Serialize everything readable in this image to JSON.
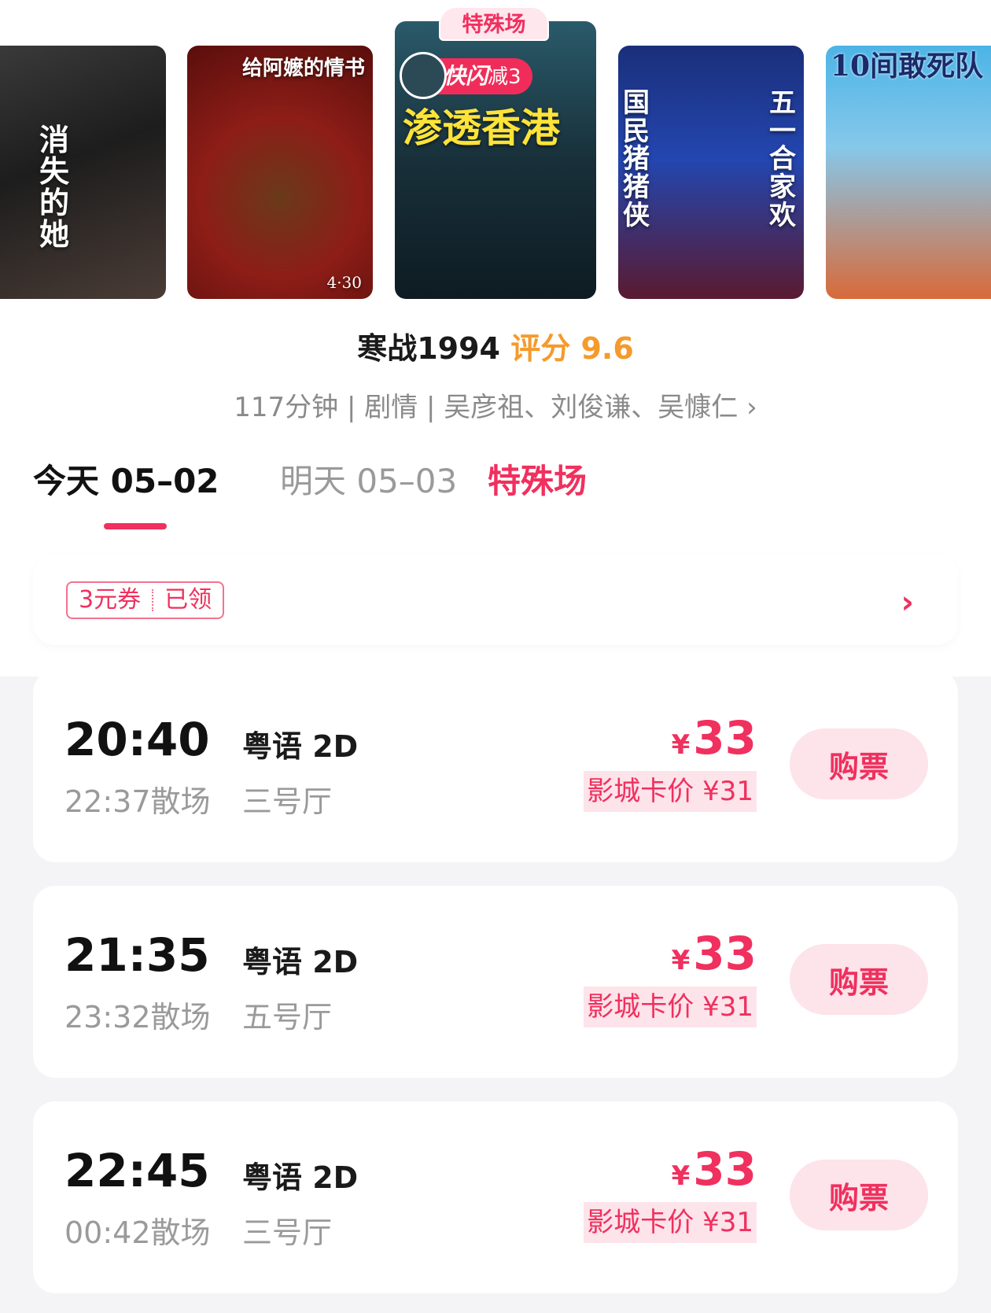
{
  "posters": [
    {
      "text": "消失的她"
    },
    {
      "text": "给阿嬷的情书",
      "date": "4·30"
    },
    {
      "text": "渗透香港"
    },
    {
      "text": "国民猪猪侠",
      "side_text": "五一合家欢"
    },
    {
      "text": "10间敢死队"
    }
  ],
  "poster_tag": "特殊场",
  "flash_badge": {
    "brand": "快闪",
    "discount": "减3"
  },
  "movie": {
    "title": "寒战1994",
    "score_label": "评分",
    "score": "9.6",
    "meta": "117分钟 | 剧情 | 吴彦祖、刘俊谦、吴慷仁 ›"
  },
  "tabs": {
    "today": "今天 05–02",
    "tomorrow": "明天 05–03",
    "special": "特殊场"
  },
  "coupon": {
    "amount": "3元券",
    "status": "已领",
    "chevron": "›"
  },
  "showtimes": [
    {
      "start": "20:40",
      "end": "22:37散场",
      "lang": "粤语 2D",
      "hall": "三号厅",
      "currency": "¥",
      "price": "33",
      "card_price": "影城卡价 ¥31",
      "buy_label": "购票"
    },
    {
      "start": "21:35",
      "end": "23:32散场",
      "lang": "粤语 2D",
      "hall": "五号厅",
      "currency": "¥",
      "price": "33",
      "card_price": "影城卡价 ¥31",
      "buy_label": "购票"
    },
    {
      "start": "22:45",
      "end": "00:42散场",
      "lang": "粤语 2D",
      "hall": "三号厅",
      "currency": "¥",
      "price": "33",
      "card_price": "影城卡价 ¥31",
      "buy_label": "购票"
    }
  ],
  "colors": {
    "accent": "#f0305e",
    "score": "#f59a2b",
    "muted": "#9a9a9a",
    "button_bg": "#fde3ea"
  }
}
